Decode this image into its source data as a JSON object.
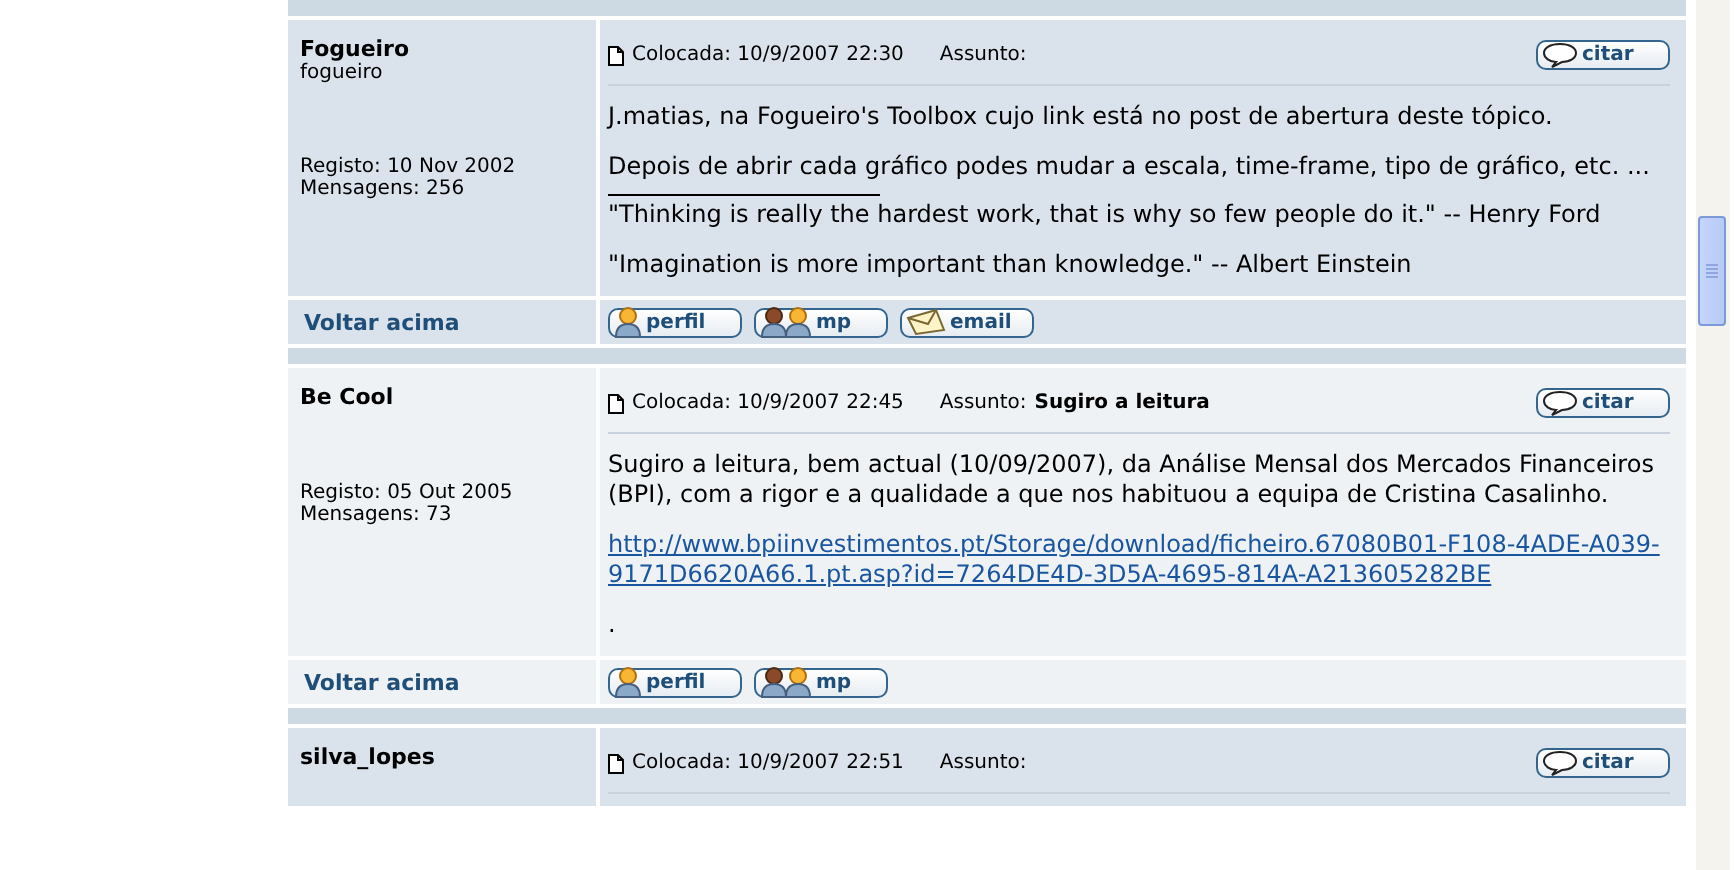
{
  "posts": [
    {
      "author": "Fogueiro",
      "username": "fogueiro",
      "registered": "Registo: 10 Nov 2002",
      "messages": "Mensagens: 256",
      "posted": "Colocada: 10/9/2007 22:30",
      "subject_label": "Assunto:",
      "quote": "citar",
      "body": [
        {
          "kind": "text",
          "text": "J.matias, na Fogueiro's Toolbox cujo link está no post de abertura deste tópico."
        },
        {
          "kind": "text",
          "text": "Depois de abrir cada gráfico podes mudar a escala, time-frame, tipo de gráfico, etc. ..."
        },
        {
          "kind": "rule"
        },
        {
          "kind": "tight",
          "text": "\"Thinking is really the hardest work, that is why so few people do it.\" -- Henry Ford"
        },
        {
          "kind": "text",
          "text": "\"Imagination is more important than knowledge.\" -- Albert Einstein"
        }
      ],
      "back": "Voltar acima",
      "buttons": [
        {
          "kind": "profile",
          "label": "perfil"
        },
        {
          "kind": "pm",
          "label": "mp"
        },
        {
          "kind": "email",
          "label": "email"
        }
      ]
    },
    {
      "author": "Be Cool",
      "registered": "Registo: 05 Out 2005",
      "messages": "Mensagens: 73",
      "posted": "Colocada: 10/9/2007 22:45",
      "subject_label": "Assunto:",
      "subject": "Sugiro a leitura",
      "quote": "citar",
      "body": [
        {
          "kind": "text",
          "text": "Sugiro a leitura, bem actual (10/09/2007), da Análise Mensal dos Mercados Financeiros (BPI), com a rigor e a qualidade a que nos habituou a equipa de Cristina Casalinho."
        },
        {
          "kind": "link",
          "text": "http://www.bpiinvestimentos.pt/Storage/download/ficheiro.67080B01-F108-4ADE-A039-9171D6620A66.1.pt.asp?id=7264DE4D-3D5A-4695-814A-A213605282BE"
        },
        {
          "kind": "text",
          "text": "."
        }
      ],
      "back": "Voltar acima",
      "buttons": [
        {
          "kind": "profile",
          "label": "perfil"
        },
        {
          "kind": "pm",
          "label": "mp"
        }
      ]
    },
    {
      "author": "silva_lopes",
      "posted": "Colocada: 10/9/2007 22:51",
      "subject_label": "Assunto:",
      "quote": "citar"
    }
  ]
}
